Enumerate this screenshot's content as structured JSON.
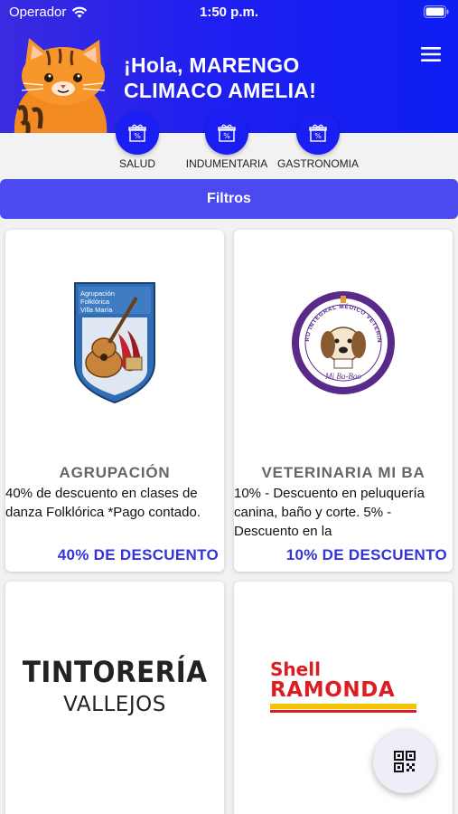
{
  "status_bar": {
    "carrier": "Operador",
    "time": "1:50 p.m."
  },
  "header": {
    "greeting": "¡Hola, MARENGO CLIMACO AMELIA!"
  },
  "categories": [
    {
      "label": "SALUD",
      "icon": "gift-percent-icon"
    },
    {
      "label": "INDUMENTARIA",
      "icon": "gift-percent-icon"
    },
    {
      "label": "GASTRONOMIA",
      "icon": "gift-percent-icon"
    }
  ],
  "filters": {
    "label": "Filtros"
  },
  "cards": [
    {
      "title": "AGRUPACIÓN",
      "description": "40% de descuento en clases de danza Folklórica *Pago contado.",
      "discount": "40% DE DESCUENTO",
      "logo_text": [
        "Agrupación",
        "Folklórica",
        "Villa María"
      ]
    },
    {
      "title": "VETERINARIA MI BA",
      "description": "10% - Descuento en peluquería canina, baño y corte. 5% - Descuento en la",
      "discount": "10% DE DESCUENTO",
      "logo_text": [
        "CENTRO INTEGRAL MÉDICO VETERINARIO",
        "Mi Ba-Bao"
      ]
    },
    {
      "logo_text": [
        "TINTORERÍA",
        "VALLEJOS"
      ]
    },
    {
      "logo_text": [
        "Shell",
        "RAMONDA"
      ]
    }
  ],
  "colors": {
    "header_start": "#3b2be0",
    "header_end": "#0d1ef2",
    "accent": "#4a4af0",
    "discount": "#3434d8"
  }
}
